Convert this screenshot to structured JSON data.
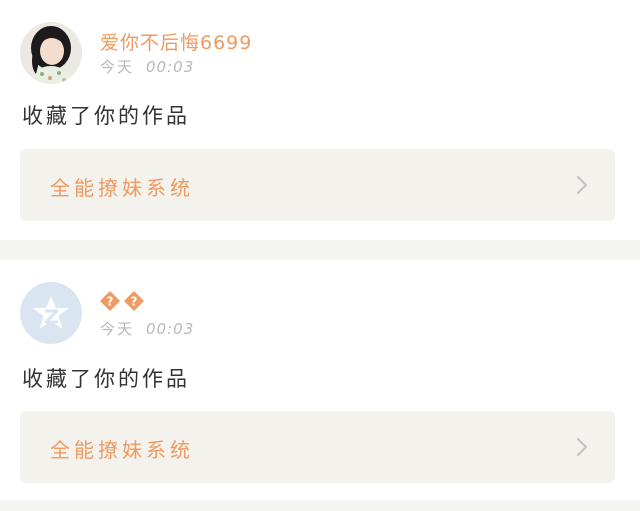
{
  "feed": [
    {
      "avatar_icon": "girl-portrait-avatar",
      "username": "爱你不后悔6699",
      "time_day": "今天",
      "time_clock": "00:03",
      "action": "收藏了你的作品",
      "work_title": "全能撩妹系统",
      "chevron_icon": "chevron-right-icon"
    },
    {
      "avatar_icon": "qq-default-avatar",
      "username_icons": [
        "question-diamond-icon",
        "question-diamond-icon"
      ],
      "time_day": "今天",
      "time_clock": "00:03",
      "action": "收藏了你的作品",
      "work_title": "全能撩妹系统",
      "chevron_icon": "chevron-right-icon"
    }
  ],
  "colors": {
    "accent_orange": "#ee9a63",
    "timestamp_gray": "#b8b8b8",
    "work_box_bg": "#f3f2ec",
    "separator_bg": "#f4f4f1",
    "avatar_qq_bg": "#d9e6f2"
  }
}
